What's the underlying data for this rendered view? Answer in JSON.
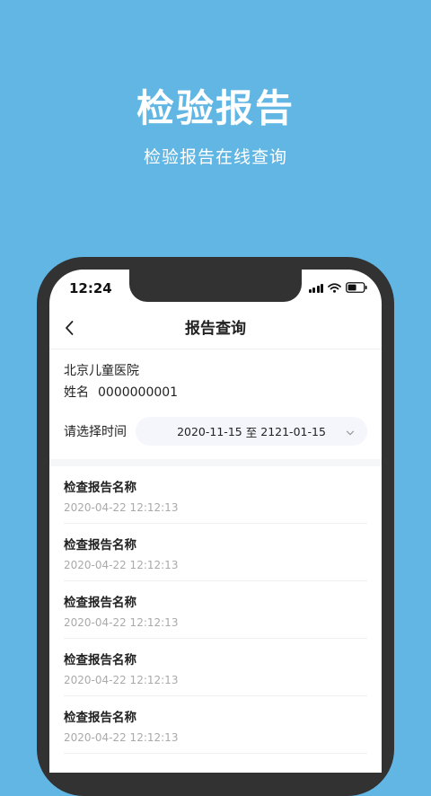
{
  "hero": {
    "title": "检验报告",
    "subtitle": "检验报告在线查询"
  },
  "status_bar": {
    "time": "12:24"
  },
  "nav": {
    "title": "报告查询"
  },
  "patient": {
    "hospital": "北京儿童医院",
    "name_label": "姓名",
    "name_value": "0000000001"
  },
  "date_filter": {
    "label": "请选择时间",
    "start": "2020-11-15",
    "separator": "至",
    "end": "2121-01-15"
  },
  "reports": [
    {
      "name": "检查报告名称",
      "time": "2020-04-22 12:12:13"
    },
    {
      "name": "检查报告名称",
      "time": "2020-04-22 12:12:13"
    },
    {
      "name": "检查报告名称",
      "time": "2020-04-22 12:12:13"
    },
    {
      "name": "检查报告名称",
      "time": "2020-04-22 12:12:13"
    },
    {
      "name": "检查报告名称",
      "time": "2020-04-22 12:12:13"
    }
  ],
  "colors": {
    "background": "#62b6e4",
    "phone_frame": "#323232",
    "muted_text": "#aaaaaa"
  },
  "icons": [
    "signal-icon",
    "wifi-icon",
    "battery-icon",
    "back-arrow-icon",
    "chevron-down-icon"
  ]
}
